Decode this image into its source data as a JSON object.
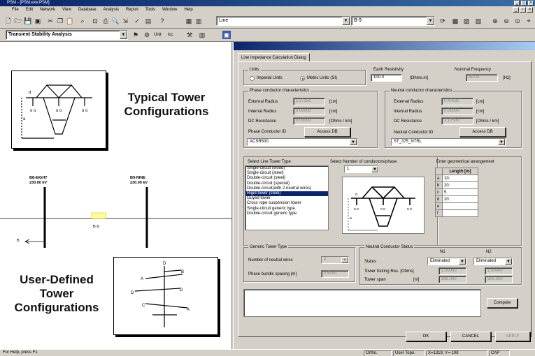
{
  "window": {
    "title": "PSM - [PSM.exe:PSM]"
  },
  "menu": [
    "File",
    "Edit",
    "Network",
    "View",
    "Database",
    "Analysis",
    "Report",
    "Tools",
    "Window",
    "Help"
  ],
  "toolbar": {
    "element_combo": "Line",
    "line_combo": "B-9",
    "mode_combo": "Transient Stability Analysis",
    "unit_label": "Unit",
    "lcc_label": "lcc"
  },
  "canvas": {
    "typical_title": "Typical Tower Configurations",
    "user_title": "User-Defined Tower Configurations",
    "bus_left": {
      "name": "B8-EIGHT",
      "kv": "230.00 kV"
    },
    "bus_right": {
      "name": "B9-NINE",
      "kv": "230.00 kV"
    },
    "line_label": "B-9",
    "arrow_label": "B"
  },
  "dialog": {
    "tab": "Line Impedance Calculation Dialog",
    "units": {
      "label": "Units",
      "imperial": "Imperial Units",
      "metric": "Metric Units (SI)",
      "selected": "metric"
    },
    "earth": {
      "label": "Earth Resistivity",
      "value": "100.0",
      "unit": "[Ohms.m]"
    },
    "freq": {
      "label": "Nominal Frequency",
      "value": "60.00",
      "unit": "[Hz]"
    },
    "phase": {
      "label": "Phase conductor characteristics",
      "ext_label": "External Radius",
      "ext_value": "1.27150",
      "ext_unit": "[cm]",
      "int_label": "Internal Radius",
      "int_value": "0.00000",
      "int_unit": "[cm]",
      "dc_label": "DC Resistance",
      "dc_value": "0.09300",
      "dc_unit": "[Ohms / km]",
      "id_label": "Phase Conductor ID",
      "access": "Access DB",
      "id_value": "ACSR500"
    },
    "neutral": {
      "label": "Neutral conductor characteristics",
      "ext_label": "External Radius",
      "ext_value": "0.47630",
      "ext_unit": "[cm]",
      "int_label": "Internal Radius",
      "int_value": "0.00000",
      "int_unit": "[cm]",
      "dc_label": "DC Resistance",
      "dc_value": "2.17500",
      "dc_unit": "[Ohms / km]",
      "id_label": "Neutral Conductor ID",
      "access": "Access DB",
      "id_value": "ST_375_NTRL"
    },
    "tower_type": {
      "label": "Select Line Tower Type",
      "items": [
        "Single-circuit (wood)",
        "Single-circuit (steel)",
        "Double-circuit (steel)",
        "Double-circuit (special)",
        "Double-circuit(with 2 neutral wires)",
        "Rigid tower (steel)",
        "Guyed tower",
        "Cross rope suspension tower",
        "Single-circuit generic type",
        "Double-circuit generic type"
      ],
      "selected_index": 5
    },
    "conductors": {
      "label": "Select Number of conductors/phase",
      "value": "1"
    },
    "geometry": {
      "label": "Enter geometrical arrangement",
      "header": "Length [m]",
      "rows": [
        {
          "key": "a",
          "value": "10."
        },
        {
          "key": "b",
          "value": "20."
        },
        {
          "key": "c",
          "value": "5."
        },
        {
          "key": "d",
          "value": "20."
        },
        {
          "key": "e",
          "value": ""
        },
        {
          "key": "f",
          "value": ""
        }
      ]
    },
    "generic": {
      "label": "Generic Tower Type",
      "neutral_wires_label": "Number of neutral wires",
      "neutral_wires_value": "2",
      "bundle_label": "Phase bundle spacing  [m]",
      "bundle_value": "0.5000"
    },
    "status": {
      "label": "Neutral Conductor Status",
      "n1": "N1",
      "n2": "N2",
      "status_label": "Status",
      "n1_status": "Eliminated",
      "n2_status": "Eliminated",
      "footing_label": "Tower footing  Res. [Ohms]",
      "footing_n1": "1.00000",
      "footing_n2": "1.00000",
      "span_label": "Tower span",
      "span_unit": "[m]",
      "span_n1": "300.000",
      "span_n2": "300.000"
    },
    "compute": "Compute",
    "ok": "OK",
    "cancel": "CANCEL",
    "apply": "APPLY"
  },
  "statusbar": {
    "help": "For Help, press F1",
    "ortho": "Ortho.",
    "topo": "User Topo.",
    "coords": "X=1319, Y=-108",
    "cap": "CAP"
  }
}
